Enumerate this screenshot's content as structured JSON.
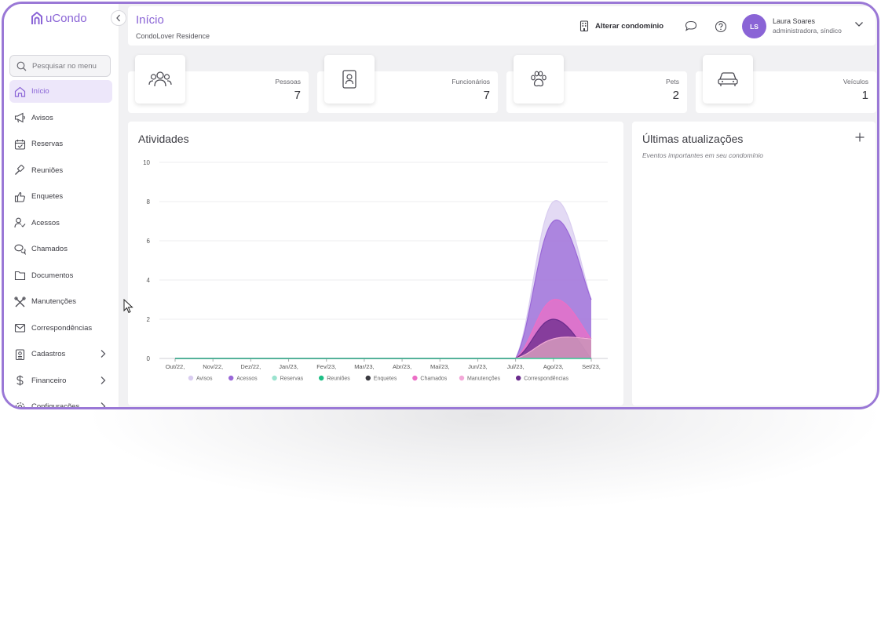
{
  "app": {
    "name": "uCondo",
    "brand_color": "#8a64d6"
  },
  "sidebar": {
    "search_placeholder": "Pesquisar no menu",
    "items": [
      {
        "label": "Início",
        "icon": "home-icon",
        "active": true
      },
      {
        "label": "Avisos",
        "icon": "megaphone-icon"
      },
      {
        "label": "Reservas",
        "icon": "calendar-check-icon"
      },
      {
        "label": "Reuniões",
        "icon": "gavel-icon"
      },
      {
        "label": "Enquetes",
        "icon": "thumbs-up-icon"
      },
      {
        "label": "Acessos",
        "icon": "user-check-icon"
      },
      {
        "label": "Chamados",
        "icon": "chat-bubbles-icon"
      },
      {
        "label": "Documentos",
        "icon": "folder-icon"
      },
      {
        "label": "Manutenções",
        "icon": "tools-icon"
      },
      {
        "label": "Correspondências",
        "icon": "mail-icon"
      },
      {
        "label": "Cadastros",
        "icon": "id-card-icon",
        "has_children": true
      },
      {
        "label": "Financeiro",
        "icon": "dollar-icon",
        "has_children": true
      },
      {
        "label": "Configurações",
        "icon": "settings-icon",
        "has_children": true
      }
    ]
  },
  "header": {
    "title": "Início",
    "subtitle": "CondoLover Residence",
    "switch_condo_label": "Alterar condomínio",
    "user": {
      "initials": "LS",
      "name": "Laura Soares",
      "role": "administradora, síndico"
    }
  },
  "stats": [
    {
      "label": "Pessoas",
      "value": "7",
      "icon": "people-icon"
    },
    {
      "label": "Funcionários",
      "value": "7",
      "icon": "badge-icon"
    },
    {
      "label": "Pets",
      "value": "2",
      "icon": "paw-icon"
    },
    {
      "label": "Veículos",
      "value": "1",
      "icon": "car-icon"
    }
  ],
  "activities": {
    "title": "Atividades"
  },
  "updates": {
    "title": "Últimas atualizações",
    "subtitle": "Eventos importantes em seu condomínio"
  },
  "chart_data": {
    "type": "area",
    "title": "",
    "xlabel": "",
    "ylabel": "",
    "ylim": [
      0,
      10
    ],
    "yticks": [
      0,
      2,
      4,
      6,
      8,
      10
    ],
    "categories": [
      "Out/22,",
      "Nov/22,",
      "Dez/22,",
      "Jan/23,",
      "Fev/23,",
      "Mar/23,",
      "Abr/23,",
      "Mai/23,",
      "Jun/23,",
      "Jul/23,",
      "Ago/23,",
      "Set/23,"
    ],
    "grid": true,
    "legend_position": "bottom",
    "series": [
      {
        "name": "Avisos",
        "color": "#d9cdf0",
        "values": [
          0,
          0,
          0,
          0,
          0,
          0,
          0,
          0,
          0,
          0,
          8,
          3
        ]
      },
      {
        "name": "Acessos",
        "color": "#9a68d8",
        "values": [
          0,
          0,
          0,
          0,
          0,
          0,
          0,
          0,
          0,
          0,
          7,
          3
        ]
      },
      {
        "name": "Reservas",
        "color": "#9be3cf",
        "values": [
          0,
          0,
          0,
          0,
          0,
          0,
          0,
          0,
          0,
          0,
          0,
          0
        ]
      },
      {
        "name": "Reuniões",
        "color": "#1fbf86",
        "values": [
          0,
          0,
          0,
          0,
          0,
          0,
          0,
          0,
          0,
          0,
          0,
          0
        ]
      },
      {
        "name": "Enquetes",
        "color": "#3a3a40",
        "values": [
          0,
          0,
          0,
          0,
          0,
          0,
          0,
          0,
          0,
          0,
          1,
          1
        ]
      },
      {
        "name": "Chamados",
        "color": "#ec6fc6",
        "values": [
          0,
          0,
          0,
          0,
          0,
          0,
          0,
          0,
          0,
          0,
          3,
          1
        ]
      },
      {
        "name": "Manutenções",
        "color": "#f3a8d8",
        "values": [
          0,
          0,
          0,
          0,
          0,
          0,
          0,
          0,
          0,
          0,
          1,
          1
        ]
      },
      {
        "name": "Correspondências",
        "color": "#6a2b8c",
        "values": [
          0,
          0,
          0,
          0,
          0,
          0,
          0,
          0,
          0,
          0,
          2,
          0
        ]
      }
    ]
  }
}
